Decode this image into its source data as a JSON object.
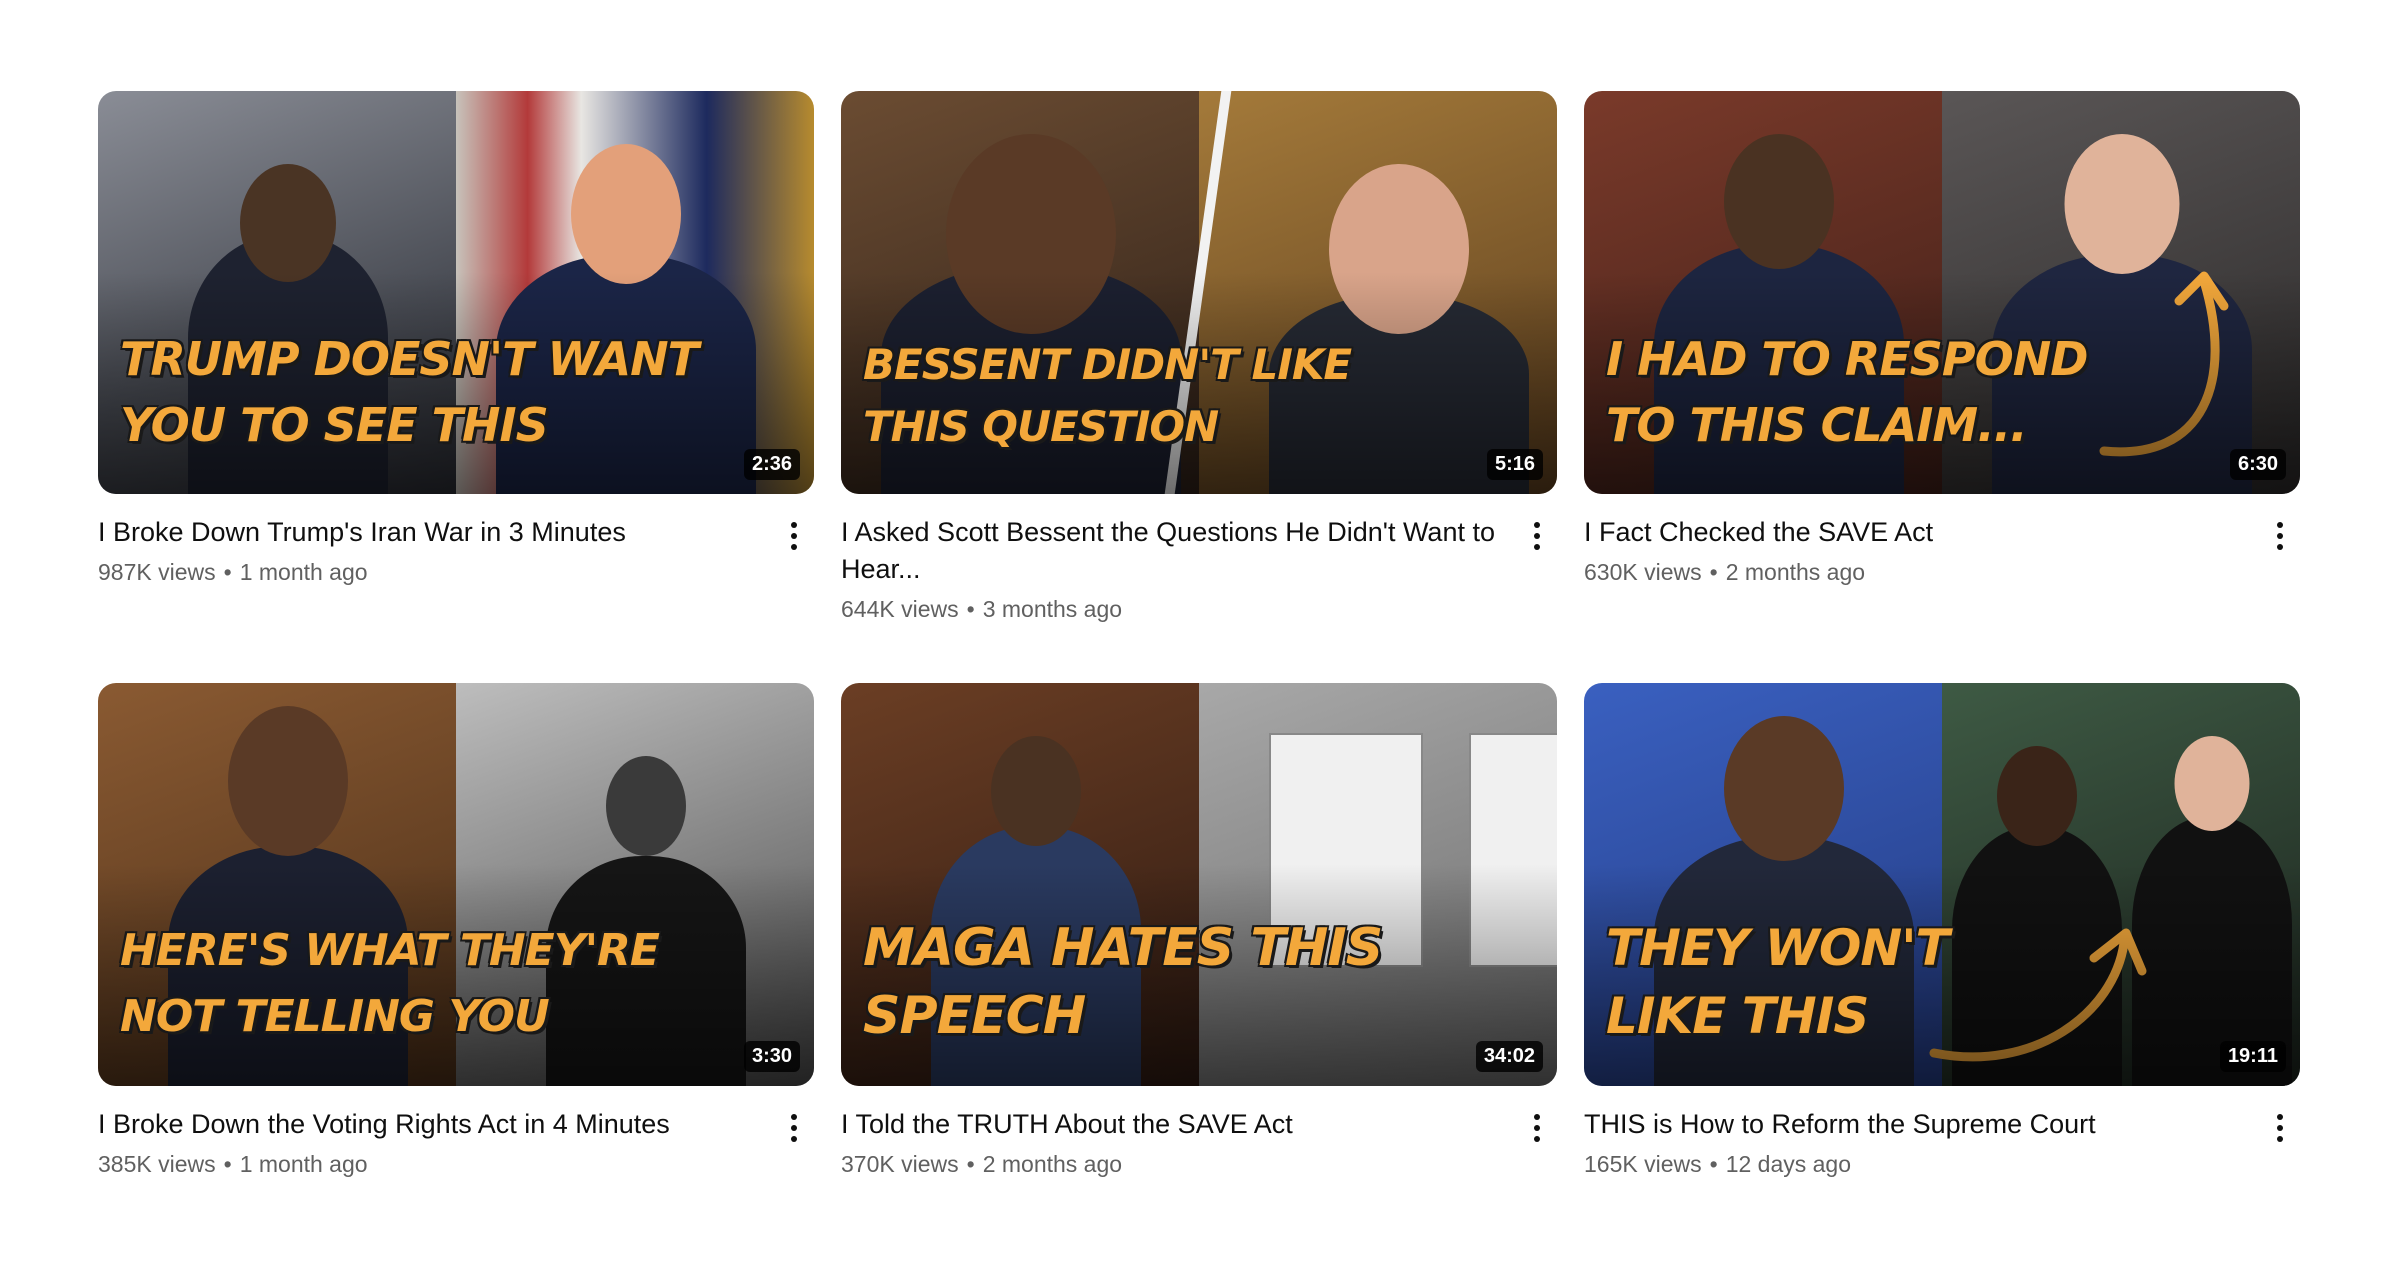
{
  "videos": [
    {
      "caption_lines": [
        "Trump doesn't want",
        "you to see this"
      ],
      "duration": "2:36",
      "title": "I Broke Down Trump's Iran War in 3 Minutes",
      "views": "987K views",
      "age": "1 month ago",
      "colors": {
        "left": "#5d6068",
        "right": "#8b7350"
      }
    },
    {
      "caption_lines": [
        "Bessent didn't like",
        "this question"
      ],
      "duration": "5:16",
      "title": "I Asked Scott Bessent the Questions He Didn't Want to Hear...",
      "views": "644K views",
      "age": "3 months ago",
      "colors": {
        "left": "#3c2a1e",
        "right": "#7a5a2e"
      }
    },
    {
      "caption_lines": [
        "I had to respond",
        "to this claim..."
      ],
      "duration": "6:30",
      "title": "I Fact Checked the SAVE Act",
      "views": "630K views",
      "age": "2 months ago",
      "colors": {
        "left": "#5a2a22",
        "right": "#3d3a3a"
      }
    },
    {
      "caption_lines": [
        "Here's what they're",
        "not telling you"
      ],
      "duration": "3:30",
      "title": "I Broke Down the Voting Rights Act in 4 Minutes",
      "views": "385K views",
      "age": "1 month ago",
      "colors": {
        "left": "#6e4a2a",
        "right": "#5a5a5a"
      }
    },
    {
      "caption_lines": [
        "MAGA hates this",
        "speech"
      ],
      "duration": "34:02",
      "title": "I Told the TRUTH About the SAVE Act",
      "views": "370K views",
      "age": "2 months ago",
      "colors": {
        "left": "#5b3420",
        "right": "#8c8c8c"
      }
    },
    {
      "caption_lines": [
        "They won't",
        "like this"
      ],
      "duration": "19:11",
      "title": "THIS is How to Reform the Supreme Court",
      "views": "165K views",
      "age": "12 days ago",
      "colors": {
        "left": "#2f4fa0",
        "right": "#2a3a2e"
      }
    }
  ],
  "accent_color": "#f3a83b",
  "menu_icon": "more-vertical-icon"
}
